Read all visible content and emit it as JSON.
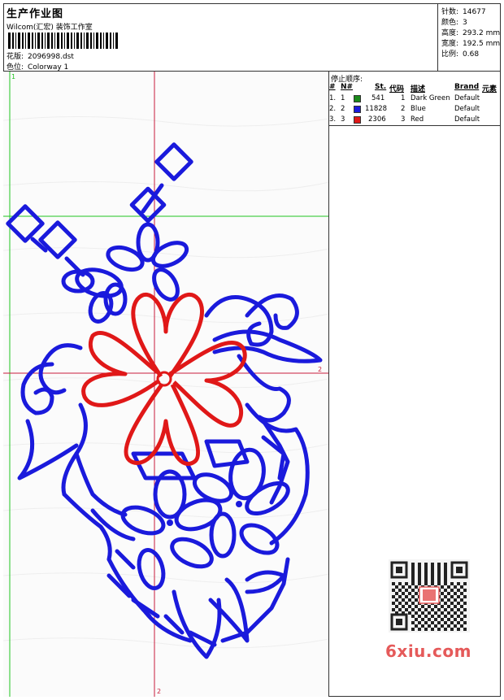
{
  "header": {
    "title": "生产作业图",
    "company": "Wilcom(汇宏) 装饰工作室",
    "design_label": "花版:",
    "design_value": "2096998.dst",
    "colorway_label": "色位:",
    "colorway_value": "Colorway 1"
  },
  "stats": {
    "stitches_label": "针数:",
    "stitches_value": "14677",
    "colors_label": "颜色:",
    "colors_value": "3",
    "height_label": "高度:",
    "height_value": "293.2 mm",
    "width_label": "宽度:",
    "width_value": "192.5 mm",
    "scale_label": "比例:",
    "scale_value": "0.68"
  },
  "stop_sequence": {
    "heading": "停止顺序:",
    "columns": [
      "#",
      "N#",
      "St.",
      "代码",
      "描述",
      "Brand",
      "元素"
    ],
    "rows": [
      {
        "num": "1.",
        "n": "1",
        "color": "#1a8a1a",
        "st": "541",
        "code": "1",
        "desc": "Dark Green",
        "brand": "Default"
      },
      {
        "num": "2.",
        "n": "2",
        "color": "#1a1adc",
        "st": "11828",
        "code": "2",
        "desc": "Blue",
        "brand": "Default"
      },
      {
        "num": "3.",
        "n": "3",
        "color": "#e01818",
        "st": "2306",
        "code": "3",
        "desc": "Red",
        "brand": "Default"
      }
    ]
  },
  "axes": {
    "v1": "1",
    "h2": "2",
    "v2": "2"
  },
  "watermark": "6xiu.com",
  "colors": {
    "blue": "#1a1adc",
    "red": "#e01818",
    "green": "#22c422",
    "guide": "#c81e3c"
  }
}
